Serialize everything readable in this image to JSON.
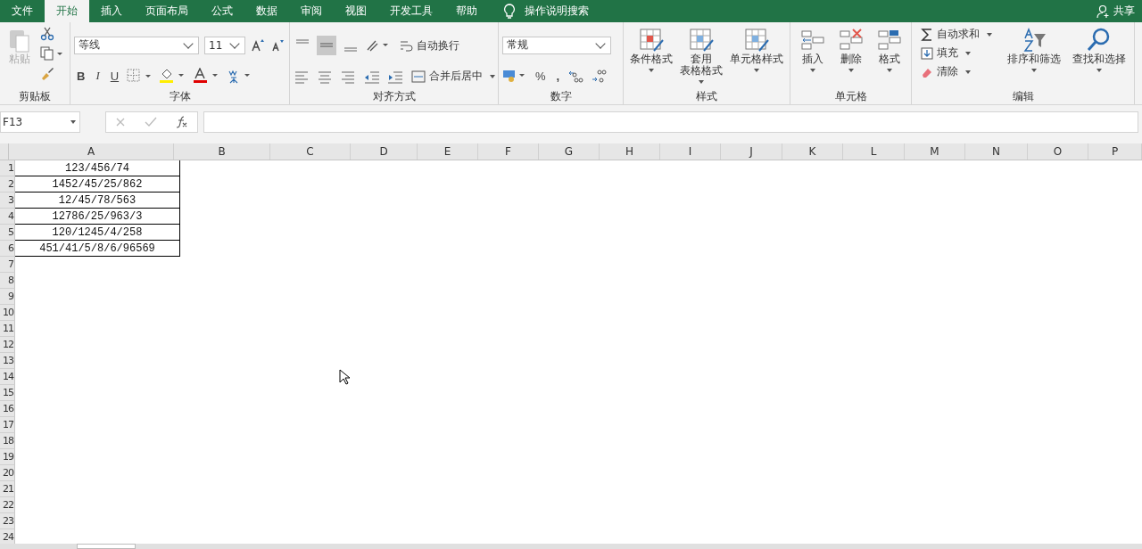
{
  "menu_tabs": [
    {
      "label": "文件",
      "selected": false
    },
    {
      "label": "开始",
      "selected": true
    },
    {
      "label": "插入",
      "selected": false
    },
    {
      "label": "页面布局",
      "selected": false
    },
    {
      "label": "公式",
      "selected": false
    },
    {
      "label": "数据",
      "selected": false
    },
    {
      "label": "审阅",
      "selected": false
    },
    {
      "label": "视图",
      "selected": false
    },
    {
      "label": "开发工具",
      "selected": false
    },
    {
      "label": "帮助",
      "selected": false
    }
  ],
  "tell_me": "操作说明搜索",
  "share": "共享",
  "ribbon": {
    "clipboard": {
      "label": "剪贴板",
      "paste": "粘贴",
      "paste_disabled": true
    },
    "font": {
      "label": "字体",
      "font_name": "等线",
      "font_size": "11",
      "bold": "B",
      "italic": "I",
      "underline": "U"
    },
    "alignment": {
      "label": "对齐方式",
      "wrap_text": "自动换行",
      "merge_center": "合并后居中"
    },
    "number": {
      "label": "数字",
      "format": "常规",
      "percent": "%",
      "comma": ","
    },
    "styles": {
      "label": "样式",
      "buttons": [
        {
          "lines": [
            "条件格式"
          ]
        },
        {
          "lines": [
            "套用",
            "表格格式"
          ]
        },
        {
          "lines": [
            "单元格样式"
          ]
        }
      ]
    },
    "cells": {
      "label": "单元格",
      "buttons": [
        "插入",
        "删除",
        "格式"
      ]
    },
    "editing": {
      "label": "编辑",
      "small": [
        "自动求和",
        "填充",
        "清除"
      ],
      "large": [
        "排序和筛选",
        "查找和选择"
      ]
    }
  },
  "name_box": "F13",
  "columns": [
    "A",
    "B",
    "C",
    "D",
    "E",
    "F",
    "G",
    "H",
    "I",
    "J",
    "K",
    "L",
    "M",
    "N",
    "O",
    "P"
  ],
  "rows": [
    {
      "header": "1",
      "a": "123/456/74"
    },
    {
      "header": "2",
      "a": "1452/45/25/862"
    },
    {
      "header": "3",
      "a": "12/45/78/563"
    },
    {
      "header": "4",
      "a": "12786/25/963/3"
    },
    {
      "header": "5",
      "a": "120/1245/4/258"
    },
    {
      "header": "6",
      "a": "451/41/5/8/6/96569"
    },
    {
      "header": "7"
    },
    {
      "header": "8"
    },
    {
      "header": "9"
    },
    {
      "header": "10"
    },
    {
      "header": "11"
    },
    {
      "header": "12"
    },
    {
      "header": "13"
    },
    {
      "header": "14"
    },
    {
      "header": "15"
    },
    {
      "header": "16"
    },
    {
      "header": "17"
    },
    {
      "header": "18"
    },
    {
      "header": "19"
    },
    {
      "header": "20"
    },
    {
      "header": "21"
    },
    {
      "header": "22"
    },
    {
      "header": "23"
    },
    {
      "header": "24"
    }
  ]
}
